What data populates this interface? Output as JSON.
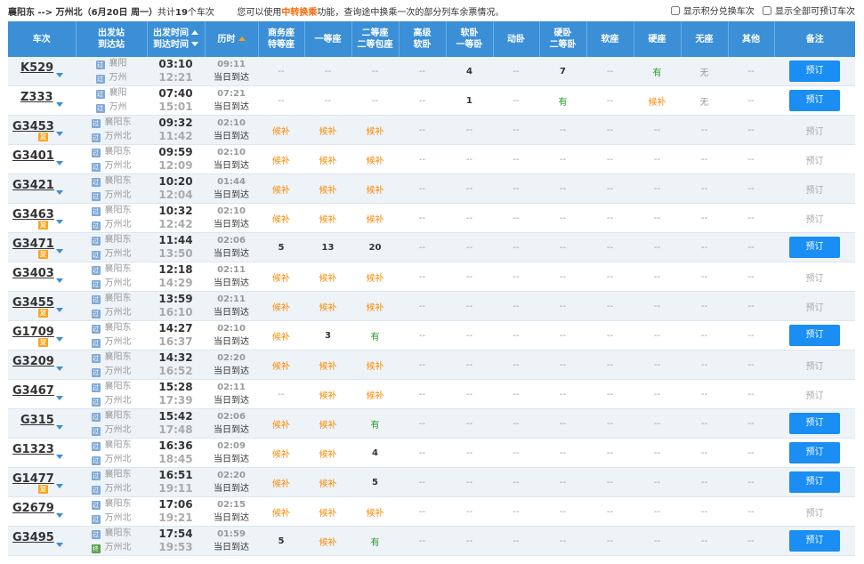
{
  "header": {
    "route": "襄阳东 --> 万州北（6月20日 周一）",
    "count_prefix": "共计",
    "count": "19",
    "count_suffix": "个车次",
    "tip_prefix": "您可以使用",
    "tip_highlight": "中转换乘",
    "tip_suffix": "功能，查询途中换乘一次的部分列车余票情况。",
    "opt_points": "显示积分兑换车次",
    "opt_all": "显示全部可预订车次"
  },
  "columns": {
    "train": "车次",
    "station_1": "出发站",
    "station_2": "到达站",
    "time_1": "出发时间",
    "time_2": "到达时间",
    "duration": "历时",
    "business_1": "商务座",
    "business_2": "特等座",
    "first": "一等座",
    "second_1": "二等座",
    "second_2": "二等包座",
    "adv_soft_1": "高级",
    "adv_soft_2": "软卧",
    "soft_1": "软卧",
    "soft_2": "一等卧",
    "moving": "动卧",
    "hard_1": "硬卧",
    "hard_2": "二等卧",
    "soft_seat": "软座",
    "hard_seat": "硬座",
    "no_seat": "无座",
    "other": "其他",
    "remark": "备注"
  },
  "icons": {
    "start_tag": "始",
    "pass_tag": "过",
    "end_tag": "终",
    "fu_tag": "复"
  },
  "colors": {
    "header_bg": "#3a8fd6",
    "button_bg": "#1a8ef2",
    "wait": "#ff8800",
    "have": "#2a9a2a"
  },
  "rows": [
    {
      "no": "K529",
      "fu": false,
      "from": "襄阳",
      "to": "万州",
      "from_tag": "过",
      "to_tag": "过",
      "dep": "03:10",
      "arr": "12:21",
      "dur": "09:11",
      "day": "当日到达",
      "seats": [
        "--",
        "--",
        "--",
        "--",
        "4",
        "--",
        "7",
        "--",
        "有",
        "无",
        "--"
      ],
      "book": "预订",
      "bookable": true
    },
    {
      "no": "Z333",
      "fu": false,
      "from": "襄阳",
      "to": "万州",
      "from_tag": "过",
      "to_tag": "过",
      "dep": "07:40",
      "arr": "15:01",
      "dur": "07:21",
      "day": "当日到达",
      "seats": [
        "--",
        "--",
        "--",
        "--",
        "1",
        "--",
        "有",
        "--",
        "候补",
        "无",
        "--"
      ],
      "book": "预订",
      "bookable": true
    },
    {
      "no": "G3453",
      "fu": true,
      "from": "襄阳东",
      "to": "万州北",
      "from_tag": "过",
      "to_tag": "过",
      "dep": "09:32",
      "arr": "11:42",
      "dur": "02:10",
      "day": "当日到达",
      "seats": [
        "候补",
        "候补",
        "候补",
        "--",
        "--",
        "--",
        "--",
        "--",
        "--",
        "--",
        "--"
      ],
      "book": "预订",
      "bookable": false
    },
    {
      "no": "G3401",
      "fu": false,
      "from": "襄阳东",
      "to": "万州北",
      "from_tag": "过",
      "to_tag": "过",
      "dep": "09:59",
      "arr": "12:09",
      "dur": "02:10",
      "day": "当日到达",
      "seats": [
        "候补",
        "候补",
        "候补",
        "--",
        "--",
        "--",
        "--",
        "--",
        "--",
        "--",
        "--"
      ],
      "book": "预订",
      "bookable": false
    },
    {
      "no": "G3421",
      "fu": false,
      "from": "襄阳东",
      "to": "万州北",
      "from_tag": "过",
      "to_tag": "过",
      "dep": "10:20",
      "arr": "12:04",
      "dur": "01:44",
      "day": "当日到达",
      "seats": [
        "候补",
        "候补",
        "候补",
        "--",
        "--",
        "--",
        "--",
        "--",
        "--",
        "--",
        "--"
      ],
      "book": "预订",
      "bookable": false
    },
    {
      "no": "G3463",
      "fu": true,
      "from": "襄阳东",
      "to": "万州北",
      "from_tag": "过",
      "to_tag": "过",
      "dep": "10:32",
      "arr": "12:42",
      "dur": "02:10",
      "day": "当日到达",
      "seats": [
        "候补",
        "候补",
        "候补",
        "--",
        "--",
        "--",
        "--",
        "--",
        "--",
        "--",
        "--"
      ],
      "book": "预订",
      "bookable": false
    },
    {
      "no": "G3471",
      "fu": true,
      "from": "襄阳东",
      "to": "万州北",
      "from_tag": "过",
      "to_tag": "过",
      "dep": "11:44",
      "arr": "13:50",
      "dur": "02:06",
      "day": "当日到达",
      "seats": [
        "5",
        "13",
        "20",
        "--",
        "--",
        "--",
        "--",
        "--",
        "--",
        "--",
        "--"
      ],
      "book": "预订",
      "bookable": true
    },
    {
      "no": "G3403",
      "fu": false,
      "from": "襄阳东",
      "to": "万州北",
      "from_tag": "过",
      "to_tag": "过",
      "dep": "12:18",
      "arr": "14:29",
      "dur": "02:11",
      "day": "当日到达",
      "seats": [
        "候补",
        "候补",
        "候补",
        "--",
        "--",
        "--",
        "--",
        "--",
        "--",
        "--",
        "--"
      ],
      "book": "预订",
      "bookable": false
    },
    {
      "no": "G3455",
      "fu": true,
      "from": "襄阳东",
      "to": "万州北",
      "from_tag": "过",
      "to_tag": "过",
      "dep": "13:59",
      "arr": "16:10",
      "dur": "02:11",
      "day": "当日到达",
      "seats": [
        "候补",
        "候补",
        "候补",
        "--",
        "--",
        "--",
        "--",
        "--",
        "--",
        "--",
        "--"
      ],
      "book": "预订",
      "bookable": false
    },
    {
      "no": "G1709",
      "fu": true,
      "from": "襄阳东",
      "to": "万州北",
      "from_tag": "过",
      "to_tag": "过",
      "dep": "14:27",
      "arr": "16:37",
      "dur": "02:10",
      "day": "当日到达",
      "seats": [
        "候补",
        "3",
        "有",
        "--",
        "--",
        "--",
        "--",
        "--",
        "--",
        "--",
        "--"
      ],
      "book": "预订",
      "bookable": true
    },
    {
      "no": "G3209",
      "fu": false,
      "from": "襄阳东",
      "to": "万州北",
      "from_tag": "过",
      "to_tag": "过",
      "dep": "14:32",
      "arr": "16:52",
      "dur": "02:20",
      "day": "当日到达",
      "seats": [
        "候补",
        "候补",
        "候补",
        "--",
        "--",
        "--",
        "--",
        "--",
        "--",
        "--",
        "--"
      ],
      "book": "预订",
      "bookable": false
    },
    {
      "no": "G3467",
      "fu": false,
      "from": "襄阳东",
      "to": "万州北",
      "from_tag": "过",
      "to_tag": "过",
      "dep": "15:28",
      "arr": "17:39",
      "dur": "02:11",
      "day": "当日到达",
      "seats": [
        "--",
        "候补",
        "候补",
        "--",
        "--",
        "--",
        "--",
        "--",
        "--",
        "--",
        "--"
      ],
      "book": "预订",
      "bookable": false
    },
    {
      "no": "G315",
      "fu": false,
      "from": "襄阳东",
      "to": "万州北",
      "from_tag": "过",
      "to_tag": "过",
      "dep": "15:42",
      "arr": "17:48",
      "dur": "02:06",
      "day": "当日到达",
      "seats": [
        "候补",
        "候补",
        "有",
        "--",
        "--",
        "--",
        "--",
        "--",
        "--",
        "--",
        "--"
      ],
      "book": "预订",
      "bookable": true
    },
    {
      "no": "G1323",
      "fu": false,
      "from": "襄阳东",
      "to": "万州北",
      "from_tag": "过",
      "to_tag": "过",
      "dep": "16:36",
      "arr": "18:45",
      "dur": "02:09",
      "day": "当日到达",
      "seats": [
        "候补",
        "候补",
        "4",
        "--",
        "--",
        "--",
        "--",
        "--",
        "--",
        "--",
        "--"
      ],
      "book": "预订",
      "bookable": true
    },
    {
      "no": "G1477",
      "fu": true,
      "from": "襄阳东",
      "to": "万州北",
      "from_tag": "过",
      "to_tag": "过",
      "dep": "16:51",
      "arr": "19:11",
      "dur": "02:20",
      "day": "当日到达",
      "seats": [
        "候补",
        "候补",
        "5",
        "--",
        "--",
        "--",
        "--",
        "--",
        "--",
        "--",
        "--"
      ],
      "book": "预订",
      "bookable": true
    },
    {
      "no": "G2679",
      "fu": false,
      "from": "襄阳东",
      "to": "万州北",
      "from_tag": "过",
      "to_tag": "过",
      "dep": "17:06",
      "arr": "19:21",
      "dur": "02:15",
      "day": "当日到达",
      "seats": [
        "候补",
        "候补",
        "候补",
        "--",
        "--",
        "--",
        "--",
        "--",
        "--",
        "--",
        "--"
      ],
      "book": "预订",
      "bookable": false
    },
    {
      "no": "G3495",
      "fu": false,
      "from": "襄阳东",
      "to": "万州北",
      "from_tag": "过",
      "to_tag": "终",
      "dep": "17:54",
      "arr": "19:53",
      "dur": "01:59",
      "day": "当日到达",
      "seats": [
        "5",
        "候补",
        "有",
        "--",
        "--",
        "--",
        "--",
        "--",
        "--",
        "--",
        "--"
      ],
      "book": "预订",
      "bookable": true
    }
  ]
}
